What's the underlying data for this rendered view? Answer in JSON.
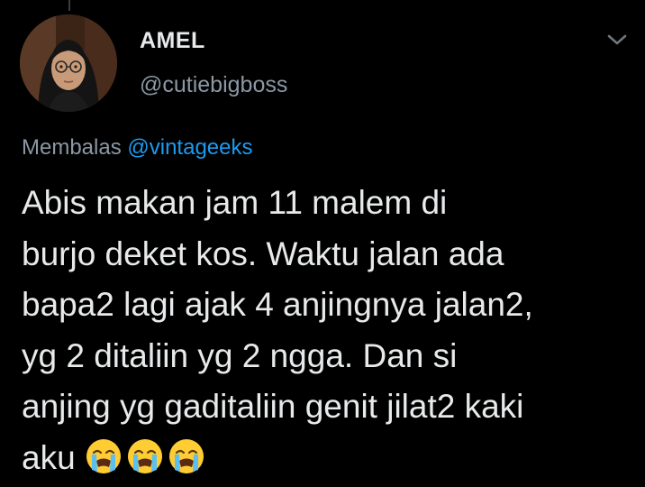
{
  "tweet": {
    "author_name": "AMEL",
    "author_handle": "@cutiebigboss",
    "reply_prefix": "Membalas",
    "reply_to": "@vintageeks",
    "body_lines": [
      "Abis makan jam 11 malem di",
      "burjo deket kos. Waktu jalan ada",
      "bapa2 lagi ajak 4 anjingnya jalan2,",
      "yg 2 ditaliin yg 2 ngga. Dan si",
      "anjing yg gaditaliin genit jilat2 kaki",
      "aku"
    ],
    "emojis": [
      "loudly-crying-face-icon",
      "loudly-crying-face-icon",
      "loudly-crying-face-icon"
    ]
  },
  "colors": {
    "background": "#000000",
    "text_primary": "#e7e9ea",
    "text_secondary": "#8b98a5",
    "link": "#1d9bf0"
  }
}
